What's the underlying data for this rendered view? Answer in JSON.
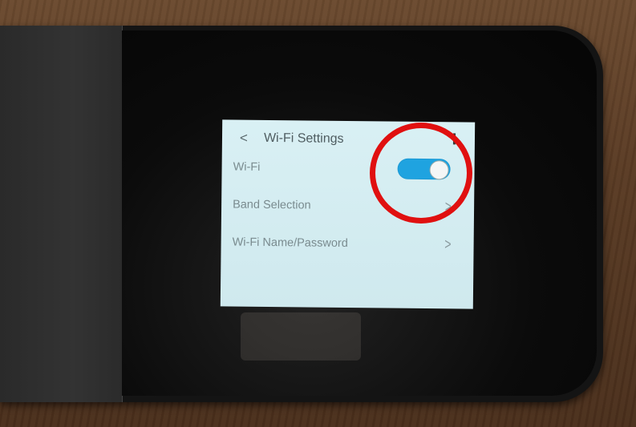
{
  "screen": {
    "header": {
      "back_glyph": "<",
      "title": "Wi-Fi Settings"
    },
    "rows": [
      {
        "label": "Wi-Fi",
        "control": "toggle",
        "on": true
      },
      {
        "label": "Band Selection",
        "chevron": ">"
      },
      {
        "label": "Wi-Fi Name/Password",
        "chevron": ">"
      }
    ]
  },
  "annotation": {
    "color": "#e01010",
    "shape": "circle",
    "target": "Wi-Fi toggle"
  },
  "colors": {
    "toggle_on": "#1fa3e0",
    "screen_bg": "#d4edf2"
  }
}
